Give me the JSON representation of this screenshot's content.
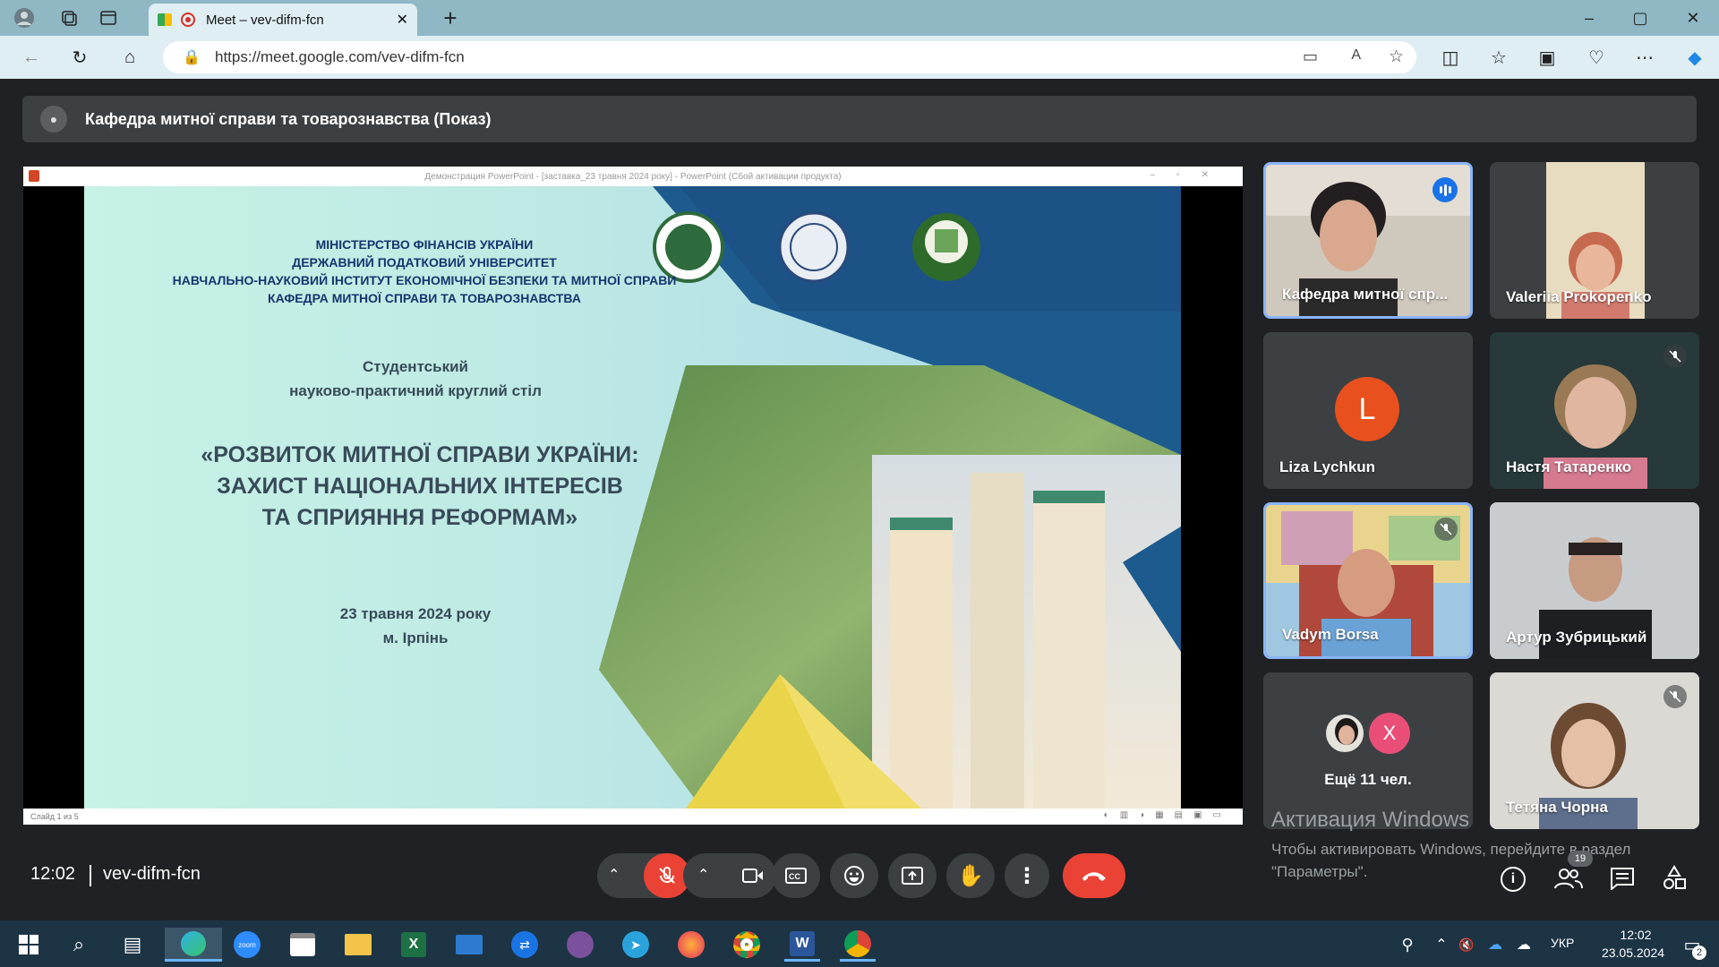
{
  "browser": {
    "tab_title": "Meet – vev-difm-fcn",
    "new_tab": "+",
    "url": "https://meet.google.com/vev-difm-fcn",
    "window_controls": [
      "–",
      "▢",
      "✕"
    ]
  },
  "meet": {
    "presenter_label": "Кафедра митної справи та товарознавства (Показ)",
    "powerpoint_title": "Демонстрация PowerPoint - [заставка_23 травня 2024 року] - PowerPoint (Сбой активации продукта)",
    "slide_status": "Слайд 1 из 5",
    "slide": {
      "header_lines": [
        "МІНІСТЕРСТВО ФІНАНСІВ УКРАЇНИ",
        "ДЕРЖАВНИЙ ПОДАТКОВИЙ УНІВЕРСИТЕТ",
        "НАВЧАЛЬНО-НАУКОВИЙ ІНСТИТУТ ЕКОНОМІЧНОЇ БЕЗПЕКИ ТА МИТНОЇ СПРАВИ",
        "КАФЕДРА МИТНОЇ СПРАВИ ТА ТОВАРОЗНАВСТВА"
      ],
      "event_line1": "Студентський",
      "event_line2": "науково-практичний круглий стіл",
      "topic_lines": [
        "«РОЗВИТОК МИТНОЇ СПРАВИ  УКРАЇНИ:",
        "ЗАХИСТ НАЦІОНАЛЬНИХ ІНТЕРЕСІВ",
        "ТА СПРИЯННЯ РЕФОРМАМ»"
      ],
      "date": "23 травня 2024 року",
      "city": "м. Ірпінь"
    },
    "participants": [
      {
        "name": "Кафедра митної спр...",
        "speaking": true
      },
      {
        "name": "Valeriia Prokopenko",
        "muted": false
      },
      {
        "name": "Liza Lychkun",
        "initial": "L",
        "avatar_color": "#e8501e"
      },
      {
        "name": "Настя Татаренко",
        "muted": true
      },
      {
        "name": "Vadym Borsa",
        "muted": true
      },
      {
        "name": "Артур Зубрицький"
      },
      {
        "name": "Ещё 11 чел.",
        "avatar_initial": "X",
        "avatar_color": "#e94e77"
      },
      {
        "name": "Тетяна Чорна",
        "muted": true
      }
    ],
    "meeting_time": "12:02",
    "meeting_code": "vev-difm-fcn",
    "participant_count": "19",
    "windows_activation_title": "Активация Windows",
    "windows_activation_text": "Чтобы активировать Windows, перейдите в раздел \"Параметры\"."
  },
  "taskbar": {
    "lang": "УКР",
    "time": "12:02",
    "date": "23.05.2024",
    "notifications": "2"
  },
  "colors": {
    "end_call": "#ea4335",
    "mic_off": "#ea4335",
    "speaking_border": "#8ab4f8"
  }
}
